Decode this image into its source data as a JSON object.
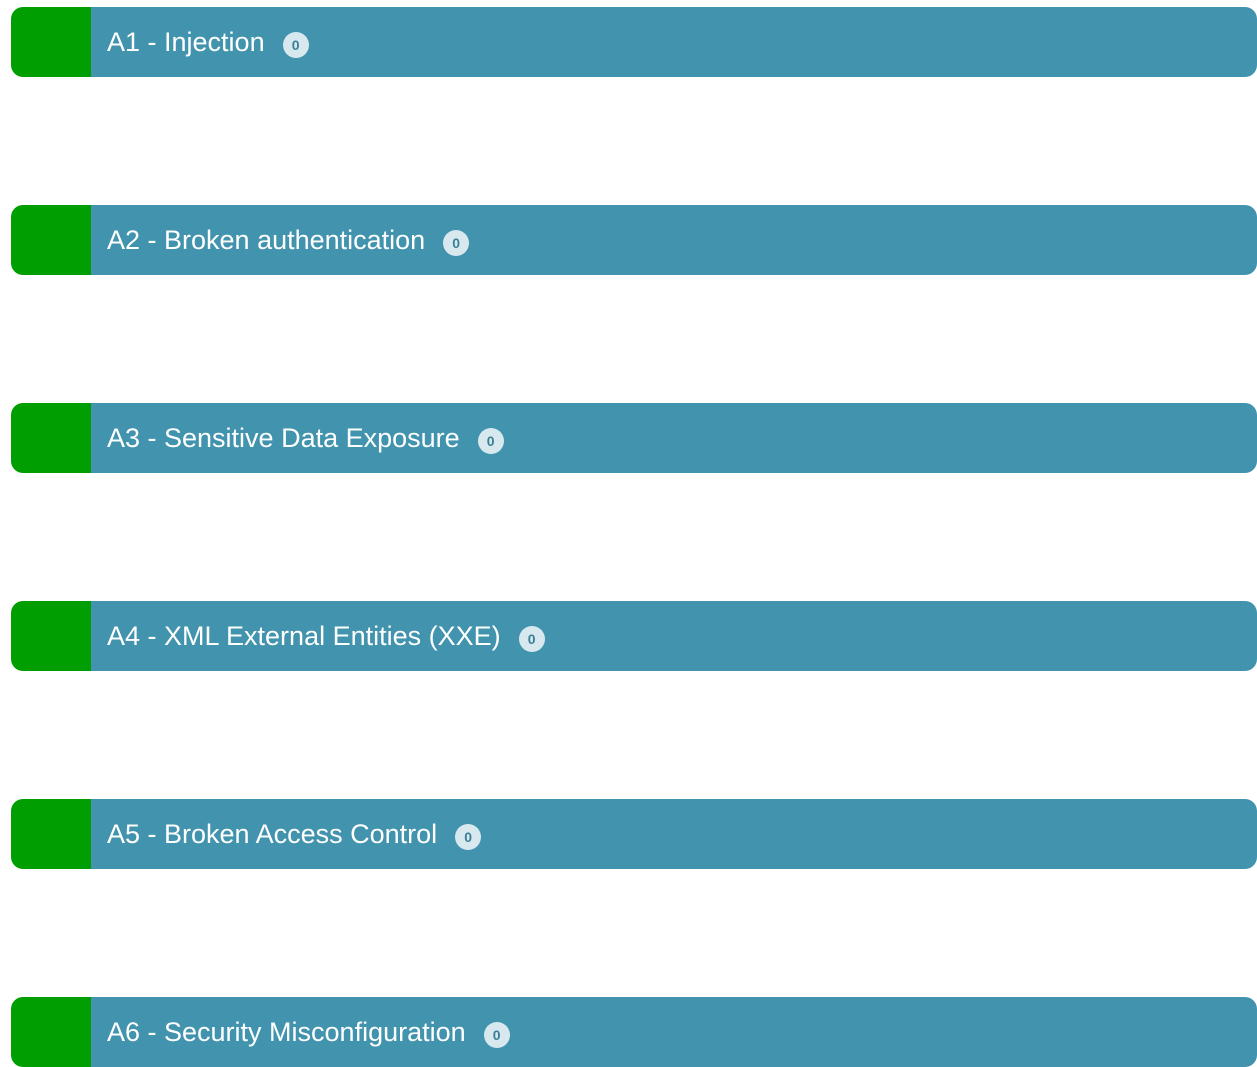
{
  "categories": [
    {
      "title": "A1 - Injection",
      "count": "0"
    },
    {
      "title": "A2 - Broken authentication",
      "count": "0"
    },
    {
      "title": "A3 - Sensitive Data Exposure",
      "count": "0"
    },
    {
      "title": "A4 - XML External Entities (XXE)",
      "count": "0"
    },
    {
      "title": "A5 - Broken Access Control",
      "count": "0"
    },
    {
      "title": "A6 - Security Misconfiguration",
      "count": "0"
    }
  ],
  "colors": {
    "status_solved": "#009e00",
    "bar_background": "#4193ae",
    "badge_background": "#d7e9ef",
    "badge_text": "#3b7f95",
    "title_text": "#ffffff"
  }
}
